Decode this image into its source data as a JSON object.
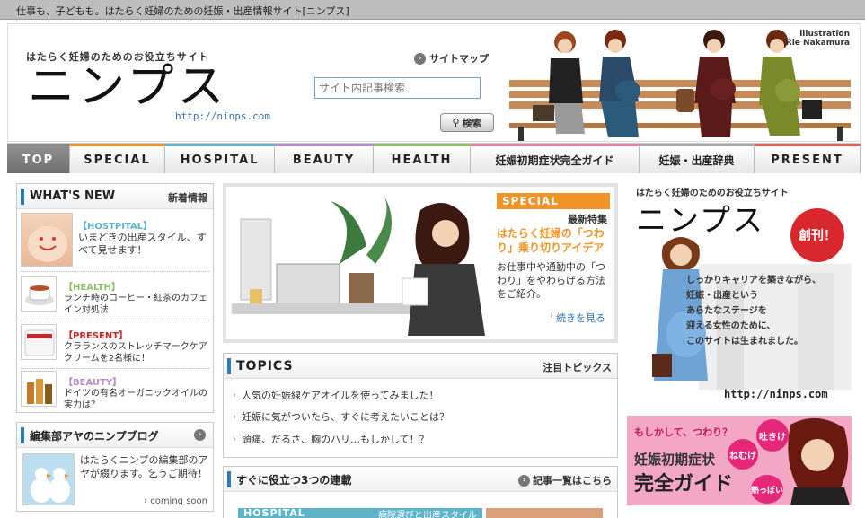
{
  "topbar": {
    "text": "仕事も、子どもも。はたらく妊婦のための妊娠・出産情報サイト[ニンプス]"
  },
  "header": {
    "tagline": "はたらく妊婦のためのお役立ちサイト",
    "logo": "ニンプス",
    "url": "http://ninps.com",
    "sitemap": "サイトマップ",
    "search_placeholder": "サイト内記事検索",
    "search_button": "検索",
    "illustration_credit_1": "illustration",
    "illustration_credit_2": "Rie Nakamura"
  },
  "nav": {
    "tabs": [
      {
        "label": "TOP"
      },
      {
        "label": "SPECIAL"
      },
      {
        "label": "HOSPITAL"
      },
      {
        "label": "BEAUTY"
      },
      {
        "label": "HEALTH"
      },
      {
        "label": "妊娠初期症状完全ガイド"
      },
      {
        "label": "妊娠・出産辞典"
      },
      {
        "label": "PRESENT"
      }
    ],
    "colors": [
      "#8a8a8a",
      "#f39325",
      "#5fb3c9",
      "#b58bc9",
      "#8cc06b",
      "#e77fa6",
      "#a7a7a7",
      "#e05a5a"
    ]
  },
  "whats_new": {
    "title_en": "WHAT'S NEW",
    "title_jp": "新着情報",
    "items": [
      {
        "cat": "【HOSTPITAL】",
        "text": "いまどきの出産スタイル、すべて見せます！",
        "color": "#5fb3c9"
      },
      {
        "cat": "【HEALTH】",
        "text": "ランチ時のコーヒー・紅茶のカフェイン対処法",
        "color": "#8cc06b"
      },
      {
        "cat": "【PRESENT】",
        "text": "クラランスのストレッチマークケアクリームを2名様に！",
        "color": "#e05a5a"
      },
      {
        "cat": "【BEAUTY】",
        "text": "ドイツの有名オーガニックオイルの実力は？",
        "color": "#b58bc9"
      }
    ]
  },
  "blog": {
    "title": "編集部アヤのニンプブログ",
    "text": "はたらくニンプの編集部のアヤが綴ります。乞うご期待！",
    "more": "coming soon"
  },
  "special": {
    "tag": "SPECIAL",
    "label": "最新特集",
    "headline": "はたらく妊婦の「つわり」乗り切りアイデア",
    "body": "お仕事中や通勤中の「つわり」をやわらげる方法をご紹介。",
    "more": "続きを見る"
  },
  "topics": {
    "title_en": "TOPICS",
    "title_jp": "注目トピックス",
    "items": [
      "人気の妊娠線ケアオイルを使ってみました！",
      "妊娠に気がついたら、すぐに考えたいことは？",
      "頭痛、だるさ、胸のハリ…もしかして！？"
    ]
  },
  "series": {
    "title": "すぐに役立つ3つの連載",
    "link": "記事一覧はこちら",
    "sub_tag": "HOSPITAL",
    "sub_text": "病院選びと出産スタイル"
  },
  "launch_ad": {
    "tagline": "はたらく妊婦のためのお役立ちサイト",
    "logo": "ニンプス",
    "badge": "創刊！",
    "copy": [
      "しっかりキャリアを築きながら、",
      "妊娠・出産という",
      "あらたなステージを",
      "迎える女性のために、",
      "このサイトは生まれました。"
    ],
    "url": "http://ninps.com"
  },
  "guide_ad": {
    "line1": "もしかして、つわり？",
    "line2": "妊娠初期症状",
    "line3": "完全ガイド",
    "bubbles": [
      "吐きけ",
      "ねむけ",
      "熱っぽい"
    ]
  }
}
